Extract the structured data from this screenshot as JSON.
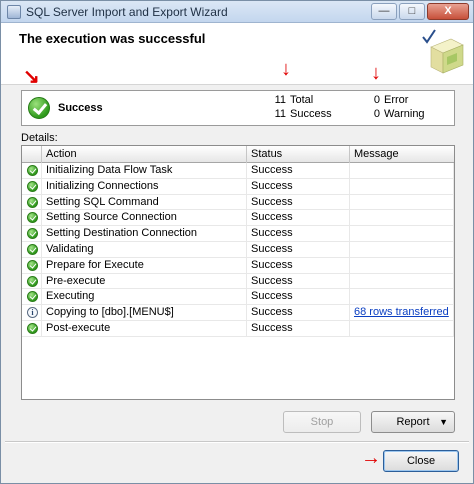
{
  "window": {
    "title": "SQL Server Import and Export Wizard",
    "controls": {
      "minimize": "—",
      "maximize": "□",
      "close": "X"
    }
  },
  "header": {
    "title": "The execution was successful"
  },
  "summary": {
    "status": "Success",
    "total_count": "11",
    "total_label": "Total",
    "success_count": "11",
    "success_label": "Success",
    "error_count": "0",
    "error_label": "Error",
    "warning_count": "0",
    "warning_label": "Warning"
  },
  "details": {
    "label": "Details:",
    "columns": {
      "action": "Action",
      "status": "Status",
      "message": "Message"
    },
    "rows": [
      {
        "icon": "success-icon",
        "action": "Initializing Data Flow Task",
        "status": "Success",
        "message": ""
      },
      {
        "icon": "success-icon",
        "action": "Initializing Connections",
        "status": "Success",
        "message": ""
      },
      {
        "icon": "success-icon",
        "action": "Setting SQL Command",
        "status": "Success",
        "message": ""
      },
      {
        "icon": "success-icon",
        "action": "Setting Source Connection",
        "status": "Success",
        "message": ""
      },
      {
        "icon": "success-icon",
        "action": "Setting Destination Connection",
        "status": "Success",
        "message": ""
      },
      {
        "icon": "success-icon",
        "action": "Validating",
        "status": "Success",
        "message": ""
      },
      {
        "icon": "success-icon",
        "action": "Prepare for Execute",
        "status": "Success",
        "message": ""
      },
      {
        "icon": "success-icon",
        "action": "Pre-execute",
        "status": "Success",
        "message": ""
      },
      {
        "icon": "success-icon",
        "action": "Executing",
        "status": "Success",
        "message": ""
      },
      {
        "icon": "info-icon",
        "action": "Copying to [dbo].[MENU$]",
        "status": "Success",
        "message": "68 rows transferred"
      },
      {
        "icon": "success-icon",
        "action": "Post-execute",
        "status": "Success",
        "message": ""
      }
    ]
  },
  "buttons": {
    "stop": "Stop",
    "report": "Report",
    "close": "Close"
  },
  "colors": {
    "annotation": "#e00000",
    "link": "#0b3fc2",
    "success": "#2f9a1c"
  }
}
